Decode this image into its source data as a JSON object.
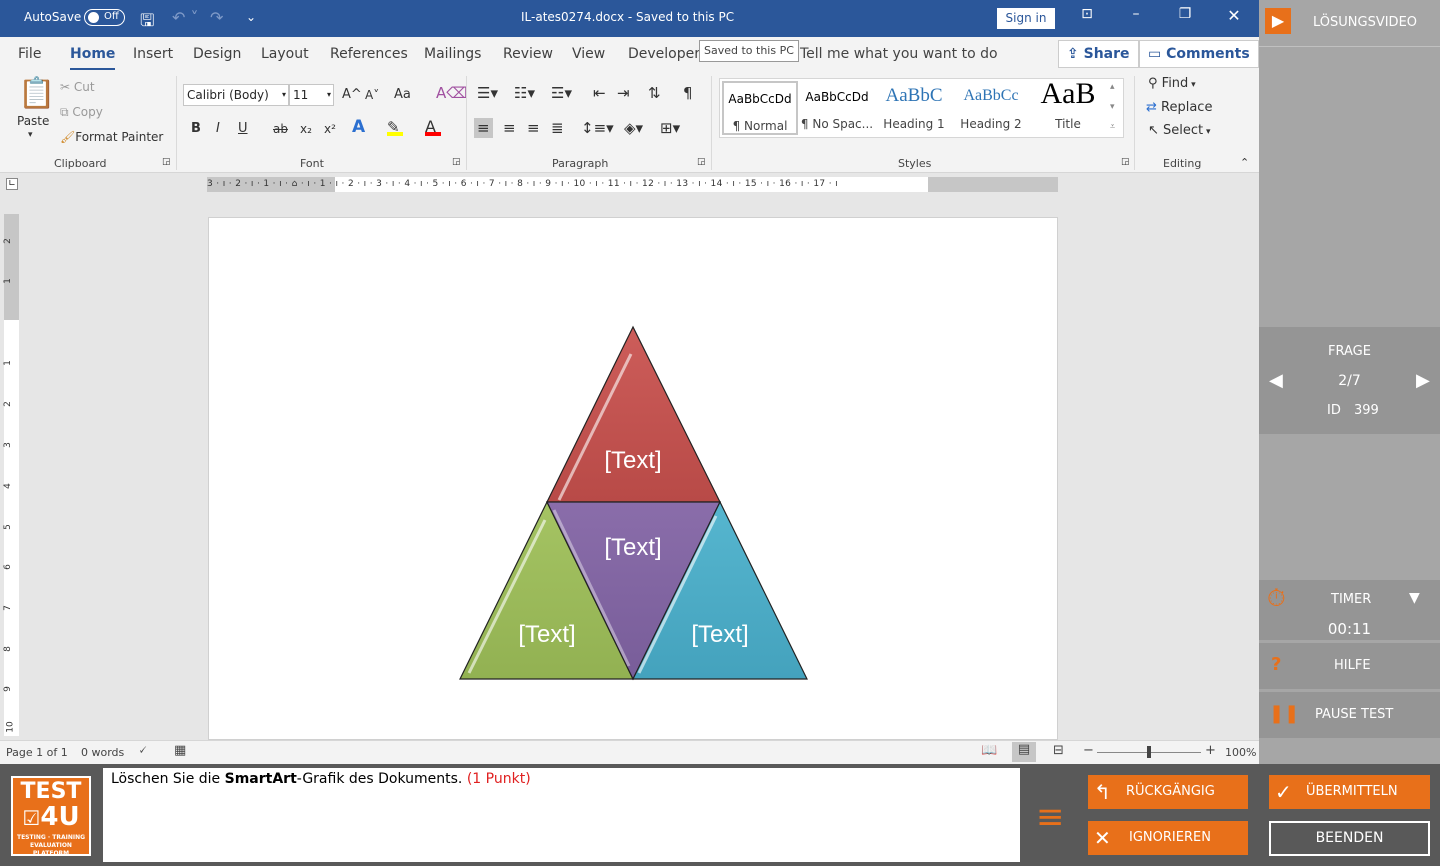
{
  "titlebar": {
    "autosave_label": "AutoSave",
    "autosave_state": "Off",
    "doc_title": "IL-ates0274.docx  -  Saved to this PC",
    "signin_label": "Sign in"
  },
  "tabs": [
    "File",
    "Home",
    "Insert",
    "Design",
    "Layout",
    "References",
    "Mailings",
    "Review",
    "View",
    "Developer"
  ],
  "active_tab": "Home",
  "tooltip": "Saved to this PC",
  "tell_me": "Tell me what you want to do",
  "share_label": "Share",
  "comments_label": "Comments",
  "ribbon": {
    "clipboard": {
      "paste": "Paste",
      "cut": "Cut",
      "copy": "Copy",
      "format_painter": "Format Painter",
      "group": "Clipboard"
    },
    "font": {
      "name": "Calibri (Body)",
      "size": "11",
      "group": "Font",
      "bold": "B",
      "italic": "I",
      "underline": "U",
      "strike": "ab",
      "sub": "x₂",
      "sup": "x²",
      "grow": "A^",
      "shrink": "A˅",
      "case": "Aa"
    },
    "paragraph": {
      "group": "Paragraph"
    },
    "styles": {
      "group": "Styles",
      "items": [
        {
          "preview": "AaBbCcDd",
          "name": "¶ Normal"
        },
        {
          "preview": "AaBbCcDd",
          "name": "¶ No Spac..."
        },
        {
          "preview": "AaBbC",
          "name": "Heading 1"
        },
        {
          "preview": "AaBbCc",
          "name": "Heading 2"
        },
        {
          "preview": "AaB",
          "name": "Title"
        }
      ]
    },
    "editing": {
      "find": "Find",
      "replace": "Replace",
      "select": "Select",
      "group": "Editing"
    }
  },
  "ruler": {
    "numbers": "3 · ı · 2 · ı · 1 · ı · ⌂ · ı · 1 · ı · 2 · ı · 3 · ı · 4 · ı · 5 · ı · 6 · ı · 7 · ı · 8 · ı · 9 · ı · 10 · ı · 11 · ı · 12 · ı · 13 · ı · 14 · ı · 15 · ı · 16 · ı · 17 · ı"
  },
  "vruler": [
    "2",
    "1",
    "1",
    "2",
    "3",
    "4",
    "5",
    "6",
    "7",
    "8",
    "9",
    "10"
  ],
  "smartart": {
    "texts": [
      "[Text]",
      "[Text]",
      "[Text]",
      "[Text]"
    ]
  },
  "status": {
    "page": "Page 1 of 1",
    "words": "0 words",
    "zoom": "100%"
  },
  "side": {
    "video": "LÖSUNGSVIDEO",
    "frage": "FRAGE",
    "question_no": "2/7",
    "id_label": "ID",
    "id_value": "399",
    "timer": "TIMER",
    "timer_value": "00:11",
    "help": "HILFE",
    "pause": "PAUSE TEST"
  },
  "task": {
    "before": "Löschen Sie die ",
    "bold": "SmartArt",
    "after": "-Grafik des Dokuments. ",
    "points": "(1 Punkt)"
  },
  "logo": {
    "line1": "TEST",
    "line2": "4U",
    "line3": "TESTING · TRAINING",
    "line4": "EVALUATION PLATFORM"
  },
  "buttons": {
    "undo": "RÜCKGÄNGIG",
    "ignore": "IGNORIEREN",
    "submit": "ÜBERMITTELN",
    "end": "BEENDEN"
  },
  "colors": {
    "word_blue": "#2b579a",
    "orange": "#e8701a",
    "red": "#c0504d",
    "purple": "#8064a2",
    "green": "#9bbb59",
    "teal": "#4bacc6"
  }
}
